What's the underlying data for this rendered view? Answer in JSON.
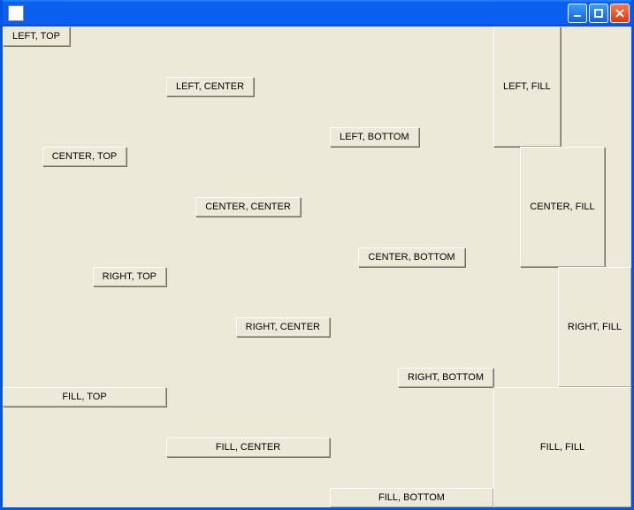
{
  "window": {
    "title": ""
  },
  "titlebar": {
    "minimize": "Minimize",
    "maximize": "Maximize",
    "close": "Close"
  },
  "buttons": {
    "r0c0": "LEFT, TOP",
    "r0c1": "LEFT, CENTER",
    "r0c2": "LEFT, BOTTOM",
    "r0c3": "LEFT, FILL",
    "r1c0": "CENTER, TOP",
    "r1c1": "CENTER, CENTER",
    "r1c2": "CENTER, BOTTOM",
    "r1c3": "CENTER, FILL",
    "r2c0": "RIGHT, TOP",
    "r2c1": "RIGHT, CENTER",
    "r2c2": "RIGHT, BOTTOM",
    "r2c3": "RIGHT, FILL",
    "r3c0": "FILL, TOP",
    "r3c1": "FILL, CENTER",
    "r3c2": "FILL, BOTTOM",
    "r3c3": "FILL, FILL"
  }
}
